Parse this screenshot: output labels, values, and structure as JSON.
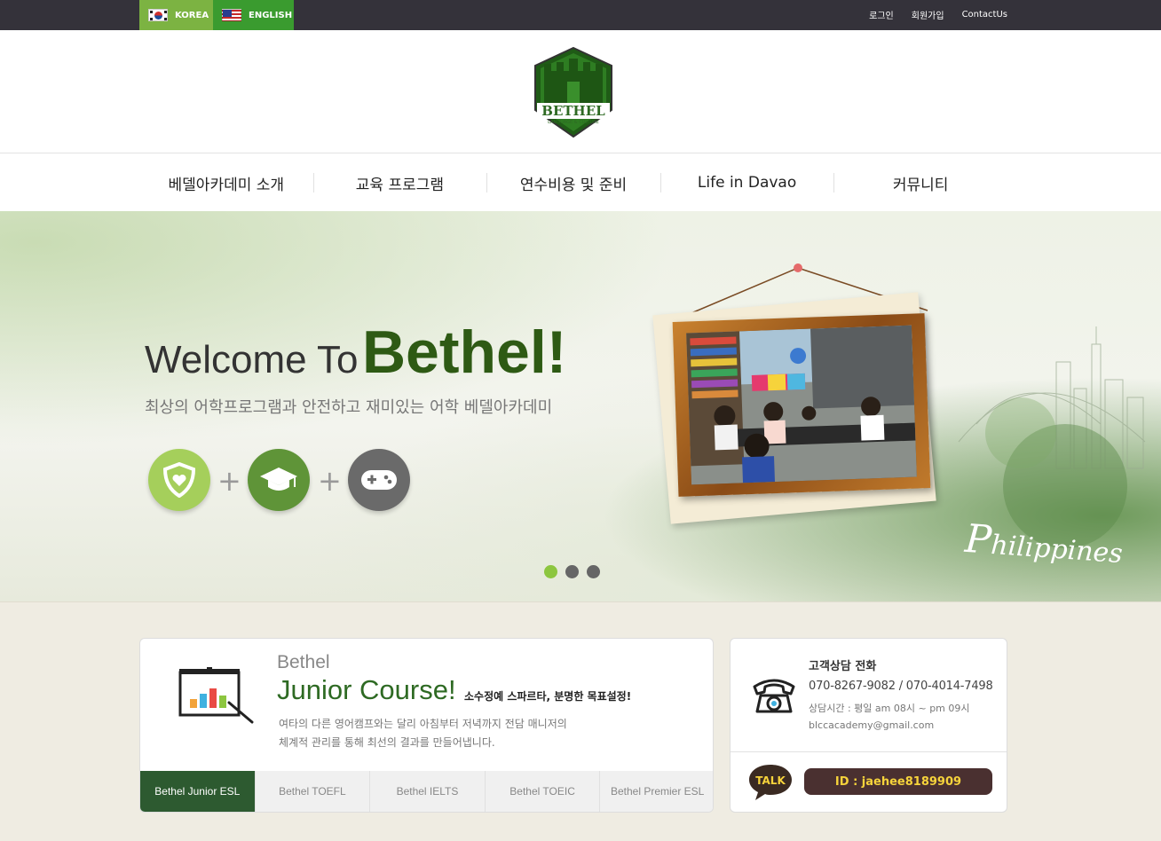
{
  "topbar": {
    "lang_korea": "KOREA",
    "lang_english": "ENGLISH",
    "login": "로그인",
    "signup": "회원가입",
    "contact": "ContactUs"
  },
  "logo": {
    "text": "BETHEL",
    "sub": "LANGUAGE & CULTURE"
  },
  "nav": {
    "items": [
      "베델아카데미 소개",
      "교육 프로그램",
      "연수비용 및 준비",
      "Life in Davao",
      "커뮤니티"
    ]
  },
  "hero": {
    "welcome": "Welcome To",
    "bethel": "Bethel!",
    "subtitle": "최상의 어학프로그램과 안전하고 재미있는 어학 베델아카데미",
    "philippines_initial": "P",
    "philippines_rest": "hilippines",
    "active_slide": 1,
    "slide_count": 3,
    "colors": {
      "circle1": "#a5cf5b",
      "circle2": "#5f9438",
      "circle3": "#6a6a6a"
    }
  },
  "course": {
    "bethel": "Bethel",
    "junior": "Junior Course!",
    "tagline": "소수정예 스파르타, 분명한 목표설정!",
    "desc_line1": "여타의 다른 영어캠프와는 달리 아침부터 저녁까지 전담 매니저의",
    "desc_line2": "체계적 관리를 통해 최선의 결과를 만들어냅니다.",
    "tabs": [
      "Bethel Junior ESL",
      "Bethel TOEFL",
      "Bethel IELTS",
      "Bethel TOEIC",
      "Bethel Premier ESL"
    ],
    "active_tab": 0
  },
  "contact": {
    "title": "고객상담 전화",
    "phone": "070-8267-9082 / 070-4014-7498",
    "hours": "상담시간 : 평일 am 08시 ~ pm 09시",
    "email": "blccacademy@gmail.com",
    "talk_label": "TALK",
    "kakao_id": "ID : jaehee8189909"
  }
}
